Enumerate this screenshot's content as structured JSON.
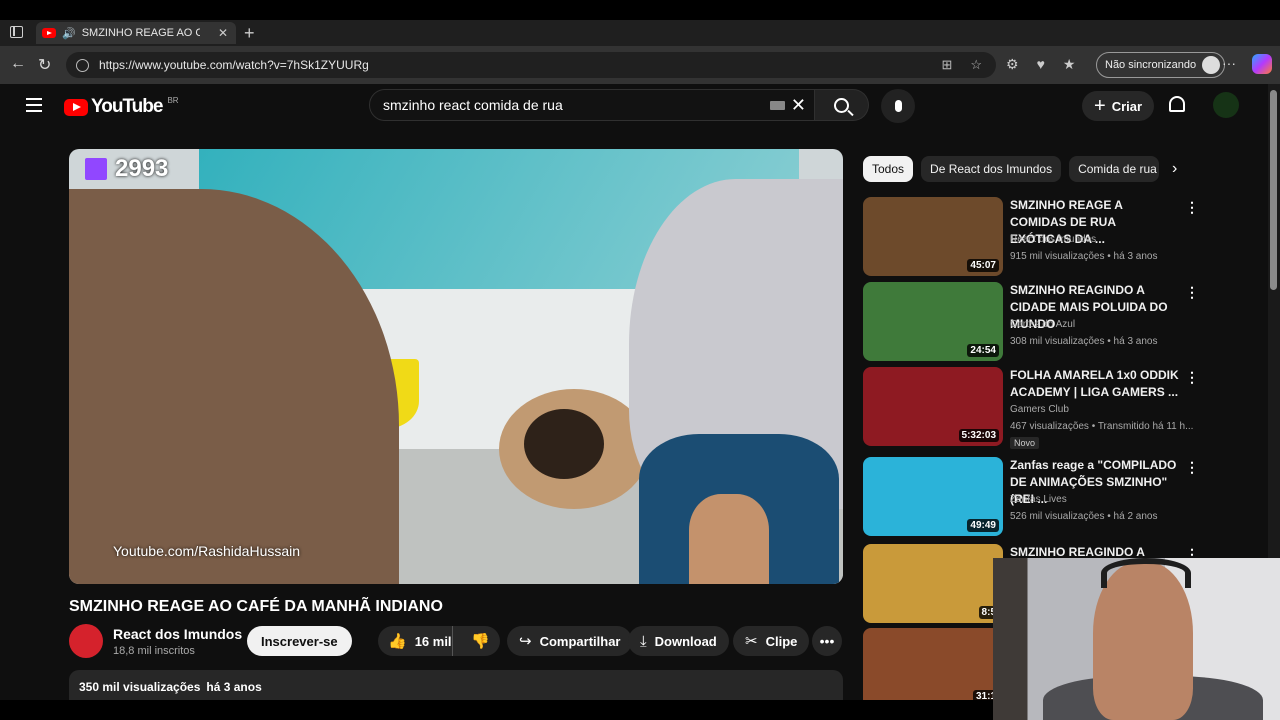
{
  "browser": {
    "tab_title": "SMZINHO REAGE AO CAFÉ DA MANHÃ INDIANO",
    "url": "https://www.youtube.com/watch?v=7hSk1ZYUURg",
    "sync_label": "Não sincronizando"
  },
  "youtube": {
    "logo_text": "YouTube",
    "country_code": "BR",
    "search_query": "smzinho react comida de rua",
    "create_label": "Criar"
  },
  "video": {
    "overlay_count": "2993",
    "watermark": "Youtube.com/RashidaHussain",
    "title": "SMZINHO REAGE AO CAFÉ DA MANHÃ INDIANO",
    "channel": "React dos Imundos",
    "subscribers": "18,8 mil inscritos",
    "subscribe_label": "Inscrever-se",
    "likes": "16 mil",
    "share_label": "Compartilhar",
    "download_label": "Download",
    "clip_label": "Clipe",
    "views": "350 mil visualizações",
    "age": "há 3 anos"
  },
  "chips": [
    "Todos",
    "De React dos Imundos",
    "Comida de rua"
  ],
  "recommendations": [
    {
      "title": "SMZINHO REAGE A COMIDAS DE RUA EXÓTICAS DA ...",
      "channel": "React dos Imundos",
      "meta": "915 mil visualizações • há 3 anos",
      "duration": "45:07",
      "thumb_color": "#6d4a2b",
      "badge": ""
    },
    {
      "title": "SMZINHO REAGINDO A CIDADE MAIS POLUIDA DO MUNDO",
      "channel": "Cortes do Azul",
      "meta": "308 mil visualizações • há 3 anos",
      "duration": "24:54",
      "thumb_color": "#3f7a3a",
      "badge": ""
    },
    {
      "title": "FOLHA AMARELA 1x0 ODDIK ACADEMY | LIGA GAMERS ...",
      "channel": "Gamers Club",
      "meta": "467 visualizações • Transmitido há 11 h...",
      "duration": "5:32:03",
      "thumb_color": "#8e1a22",
      "badge": "Novo"
    },
    {
      "title": "Zanfas reage a \"COMPILADO DE ANIMAÇÕES SMZINHO\" (REI ...",
      "channel": "Zanfas Lives",
      "meta": "526 mil visualizações • há 2 anos",
      "duration": "49:49",
      "thumb_color": "#2bb3d9",
      "badge": ""
    },
    {
      "title": "SMZINHO REAGINDO A",
      "channel": "",
      "meta": "",
      "duration": "8:5",
      "thumb_color": "#c99a3a",
      "badge": ""
    },
    {
      "title": "",
      "channel": "",
      "meta": "",
      "duration": "31:1",
      "thumb_color": "#8a4a2a",
      "badge": ""
    }
  ]
}
